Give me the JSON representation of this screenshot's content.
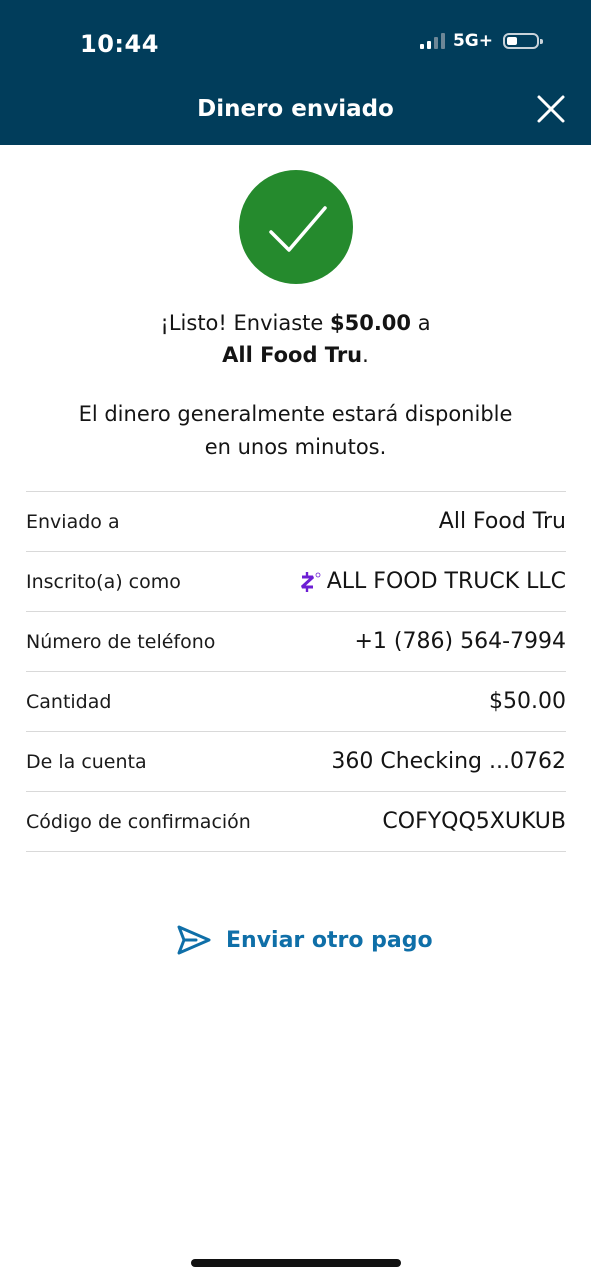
{
  "status_bar": {
    "time": "10:44",
    "network": "5G+"
  },
  "header": {
    "title": "Dinero enviado"
  },
  "confirmation": {
    "line1_prefix": "¡Listo! Enviaste ",
    "amount": "$50.00",
    "line1_suffix": " a",
    "recipient": "All Food Tru",
    "period": ".",
    "availability_line1": "El dinero generalmente estará disponible",
    "availability_line2": "en unos minutos."
  },
  "details": [
    {
      "label": "Enviado a",
      "value": "All Food Tru"
    },
    {
      "label": "Inscrito(a) como",
      "value": "ALL FOOD TRUCK LLC"
    },
    {
      "label": "Número de teléfono",
      "value": "+1 (786) 564-7994"
    },
    {
      "label": "Cantidad",
      "value": "$50.00"
    },
    {
      "label": "De la cuenta",
      "value": "360 Checking ...0762"
    },
    {
      "label": "Código de confirmación",
      "value": "COFYQQ5XUKUB"
    }
  ],
  "actions": {
    "send_another": "Enviar otro pago"
  },
  "colors": {
    "header_bg": "#013d5b",
    "success_green": "#258a2d",
    "link_blue": "#0f6fa8",
    "zelle_purple": "#6d1ed4"
  },
  "icons": {
    "close": "close-icon",
    "success": "checkmark-icon",
    "zelle": "zelle-logo-icon",
    "send": "paper-plane-icon"
  }
}
